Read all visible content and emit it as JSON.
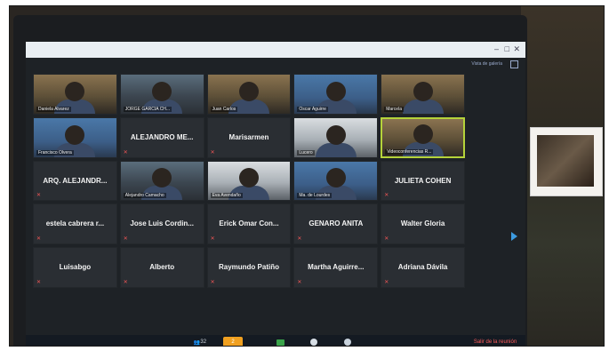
{
  "screen": {
    "view_toggle": "Vista de galería"
  },
  "tiles": [
    {
      "name": "Daniela Alvarez",
      "style": "video warm"
    },
    {
      "name": "JORGE GARCIA CH...",
      "style": "video"
    },
    {
      "name": "Juan Carlos",
      "style": "video warm"
    },
    {
      "name": "Oscar Aguirre",
      "style": "video blue"
    },
    {
      "name": "Marcela",
      "style": "video warm"
    },
    {
      "name": "Francisco Olvera",
      "style": "video blue"
    },
    {
      "name": "ALEJANDRO ME...",
      "style": "text"
    },
    {
      "name": "Marisarmen",
      "style": "text"
    },
    {
      "name": "Lucero",
      "style": "video light"
    },
    {
      "name": "Videoconferencias R...",
      "style": "video warm active"
    },
    {
      "name": "ARQ. ALEJANDR...",
      "style": "text"
    },
    {
      "name": "Alejandro Camacho",
      "style": "video"
    },
    {
      "name": "Eva Avendaño",
      "style": "video light"
    },
    {
      "name": "Ma. de Lourdes",
      "style": "video blue"
    },
    {
      "name": "JULIETA COHEN",
      "style": "text"
    },
    {
      "name": "estela cabrera r...",
      "style": "text"
    },
    {
      "name": "Jose Luis Cordin...",
      "style": "text"
    },
    {
      "name": "Erick Omar Con...",
      "style": "text"
    },
    {
      "name": "GENARO ANITA",
      "style": "text"
    },
    {
      "name": "Walter Gloria",
      "style": "text"
    },
    {
      "name": "Luisabgo",
      "style": "text"
    },
    {
      "name": "Alberto",
      "style": "text"
    },
    {
      "name": "Raymundo Patiño",
      "style": "text"
    },
    {
      "name": "Martha Aguirre...",
      "style": "text"
    },
    {
      "name": "Adriana Dávila",
      "style": "text"
    }
  ],
  "toolbar": {
    "participants_count": "32",
    "chat_count": "2",
    "leave_label": "Salir de la reunión"
  }
}
